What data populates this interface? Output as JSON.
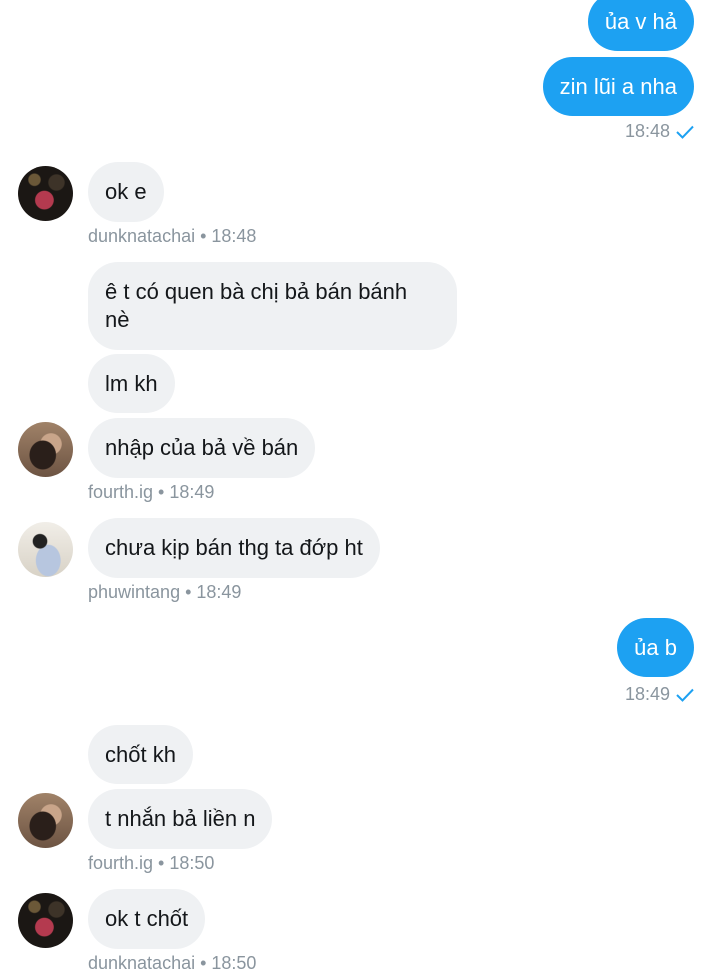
{
  "messages": [
    {
      "text": "ủa v hả"
    },
    {
      "text": "zin lũi a nha"
    },
    {
      "text": "ok e"
    },
    {
      "text": "ê t có quen bà chị bả bán bánh\nnè"
    },
    {
      "text": "lm kh"
    },
    {
      "text": "nhập của bả về bán"
    },
    {
      "text": "chưa kịp bán thg ta đớp ht"
    },
    {
      "text": "ủa b"
    },
    {
      "text": "chốt kh"
    },
    {
      "text": "t nhắn bả liền n"
    },
    {
      "text": "ok t chốt"
    }
  ],
  "meta": [
    {
      "text": "18:48"
    },
    {
      "text": "dunknatachai • 18:48"
    },
    {
      "text": "fourth.ig • 18:49"
    },
    {
      "text": "phuwintang • 18:49"
    },
    {
      "text": "18:49"
    },
    {
      "text": "fourth.ig • 18:50"
    },
    {
      "text": "dunknatachai • 18:50"
    }
  ],
  "colors": {
    "outgoing_bubble": "#1da1f2",
    "incoming_bubble": "#eff1f3",
    "meta_text": "#8a959e",
    "read_check": "#1da1f2"
  },
  "icons": {
    "read_receipt": "checkmark-icon"
  }
}
